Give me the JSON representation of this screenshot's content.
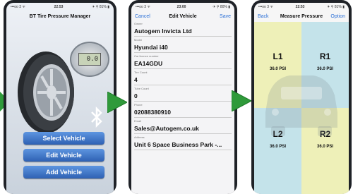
{
  "colors": {
    "accent": "#2b6fd6",
    "arrow": "#2f9a3a",
    "button": "#3f75c8"
  },
  "home": {
    "status": {
      "left": "•••oo 3 ᯤ",
      "time": "22:53",
      "right": "✈ ⚲ 81% ▮"
    },
    "title": "BT Tire Pressure Manager",
    "gauge_reading": "0.0",
    "bluetooth_icon": "bluetooth-icon",
    "buttons": [
      "Select Vehicle",
      "Edit Vehicle",
      "Add Vehicle"
    ]
  },
  "edit": {
    "status": {
      "left": "•••oo 3 ᯤ",
      "time": "23:00",
      "right": "✈ ⚲ 80% ▮"
    },
    "cancel": "Cancel",
    "title": "Edit Vehicle",
    "save": "Save",
    "fields": [
      {
        "label": "Owner",
        "value": "Autogem Invicta Ltd"
      },
      {
        "label": "Model",
        "value": "Hyundai i40"
      },
      {
        "label": "Car licence number",
        "value": "EA14GDU"
      },
      {
        "label": "Tire Count",
        "value": "4"
      },
      {
        "label": "Tube Count",
        "value": "0"
      },
      {
        "label": "Phone",
        "value": "02088380910"
      },
      {
        "label": "Email",
        "value": "Sales@Autogem.co.uk"
      },
      {
        "label": "Address",
        "value": "Unit 6 Space Business Park -..."
      }
    ]
  },
  "measure": {
    "status": {
      "left": "•••oo 3 ᯤ",
      "time": "22:53",
      "right": "✈ ⚲ 81% ▮"
    },
    "back": "Back",
    "title": "Measure Pressure",
    "options": "Option",
    "tires": [
      {
        "pos": "L1",
        "psi": "36.0 PSI"
      },
      {
        "pos": "R1",
        "psi": "36.0 PSI"
      },
      {
        "pos": "L2",
        "psi": "36.0 PSI"
      },
      {
        "pos": "R2",
        "psi": "36.0 PSI"
      }
    ]
  }
}
